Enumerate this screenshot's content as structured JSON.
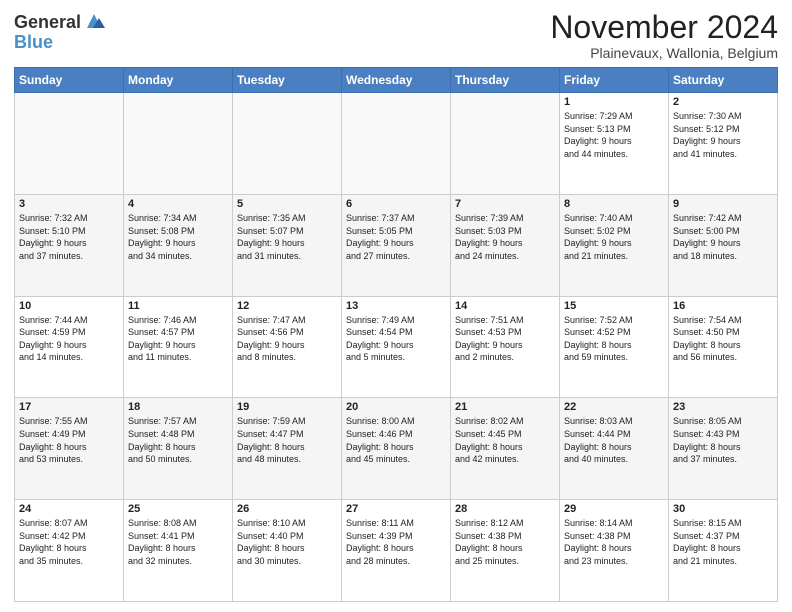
{
  "header": {
    "logo_general": "General",
    "logo_blue": "Blue",
    "title": "November 2024",
    "subtitle": "Plainevaux, Wallonia, Belgium"
  },
  "days_of_week": [
    "Sunday",
    "Monday",
    "Tuesday",
    "Wednesday",
    "Thursday",
    "Friday",
    "Saturday"
  ],
  "weeks": [
    [
      {
        "day": "",
        "info": ""
      },
      {
        "day": "",
        "info": ""
      },
      {
        "day": "",
        "info": ""
      },
      {
        "day": "",
        "info": ""
      },
      {
        "day": "",
        "info": ""
      },
      {
        "day": "1",
        "info": "Sunrise: 7:29 AM\nSunset: 5:13 PM\nDaylight: 9 hours\nand 44 minutes."
      },
      {
        "day": "2",
        "info": "Sunrise: 7:30 AM\nSunset: 5:12 PM\nDaylight: 9 hours\nand 41 minutes."
      }
    ],
    [
      {
        "day": "3",
        "info": "Sunrise: 7:32 AM\nSunset: 5:10 PM\nDaylight: 9 hours\nand 37 minutes."
      },
      {
        "day": "4",
        "info": "Sunrise: 7:34 AM\nSunset: 5:08 PM\nDaylight: 9 hours\nand 34 minutes."
      },
      {
        "day": "5",
        "info": "Sunrise: 7:35 AM\nSunset: 5:07 PM\nDaylight: 9 hours\nand 31 minutes."
      },
      {
        "day": "6",
        "info": "Sunrise: 7:37 AM\nSunset: 5:05 PM\nDaylight: 9 hours\nand 27 minutes."
      },
      {
        "day": "7",
        "info": "Sunrise: 7:39 AM\nSunset: 5:03 PM\nDaylight: 9 hours\nand 24 minutes."
      },
      {
        "day": "8",
        "info": "Sunrise: 7:40 AM\nSunset: 5:02 PM\nDaylight: 9 hours\nand 21 minutes."
      },
      {
        "day": "9",
        "info": "Sunrise: 7:42 AM\nSunset: 5:00 PM\nDaylight: 9 hours\nand 18 minutes."
      }
    ],
    [
      {
        "day": "10",
        "info": "Sunrise: 7:44 AM\nSunset: 4:59 PM\nDaylight: 9 hours\nand 14 minutes."
      },
      {
        "day": "11",
        "info": "Sunrise: 7:46 AM\nSunset: 4:57 PM\nDaylight: 9 hours\nand 11 minutes."
      },
      {
        "day": "12",
        "info": "Sunrise: 7:47 AM\nSunset: 4:56 PM\nDaylight: 9 hours\nand 8 minutes."
      },
      {
        "day": "13",
        "info": "Sunrise: 7:49 AM\nSunset: 4:54 PM\nDaylight: 9 hours\nand 5 minutes."
      },
      {
        "day": "14",
        "info": "Sunrise: 7:51 AM\nSunset: 4:53 PM\nDaylight: 9 hours\nand 2 minutes."
      },
      {
        "day": "15",
        "info": "Sunrise: 7:52 AM\nSunset: 4:52 PM\nDaylight: 8 hours\nand 59 minutes."
      },
      {
        "day": "16",
        "info": "Sunrise: 7:54 AM\nSunset: 4:50 PM\nDaylight: 8 hours\nand 56 minutes."
      }
    ],
    [
      {
        "day": "17",
        "info": "Sunrise: 7:55 AM\nSunset: 4:49 PM\nDaylight: 8 hours\nand 53 minutes."
      },
      {
        "day": "18",
        "info": "Sunrise: 7:57 AM\nSunset: 4:48 PM\nDaylight: 8 hours\nand 50 minutes."
      },
      {
        "day": "19",
        "info": "Sunrise: 7:59 AM\nSunset: 4:47 PM\nDaylight: 8 hours\nand 48 minutes."
      },
      {
        "day": "20",
        "info": "Sunrise: 8:00 AM\nSunset: 4:46 PM\nDaylight: 8 hours\nand 45 minutes."
      },
      {
        "day": "21",
        "info": "Sunrise: 8:02 AM\nSunset: 4:45 PM\nDaylight: 8 hours\nand 42 minutes."
      },
      {
        "day": "22",
        "info": "Sunrise: 8:03 AM\nSunset: 4:44 PM\nDaylight: 8 hours\nand 40 minutes."
      },
      {
        "day": "23",
        "info": "Sunrise: 8:05 AM\nSunset: 4:43 PM\nDaylight: 8 hours\nand 37 minutes."
      }
    ],
    [
      {
        "day": "24",
        "info": "Sunrise: 8:07 AM\nSunset: 4:42 PM\nDaylight: 8 hours\nand 35 minutes."
      },
      {
        "day": "25",
        "info": "Sunrise: 8:08 AM\nSunset: 4:41 PM\nDaylight: 8 hours\nand 32 minutes."
      },
      {
        "day": "26",
        "info": "Sunrise: 8:10 AM\nSunset: 4:40 PM\nDaylight: 8 hours\nand 30 minutes."
      },
      {
        "day": "27",
        "info": "Sunrise: 8:11 AM\nSunset: 4:39 PM\nDaylight: 8 hours\nand 28 minutes."
      },
      {
        "day": "28",
        "info": "Sunrise: 8:12 AM\nSunset: 4:38 PM\nDaylight: 8 hours\nand 25 minutes."
      },
      {
        "day": "29",
        "info": "Sunrise: 8:14 AM\nSunset: 4:38 PM\nDaylight: 8 hours\nand 23 minutes."
      },
      {
        "day": "30",
        "info": "Sunrise: 8:15 AM\nSunset: 4:37 PM\nDaylight: 8 hours\nand 21 minutes."
      }
    ]
  ]
}
